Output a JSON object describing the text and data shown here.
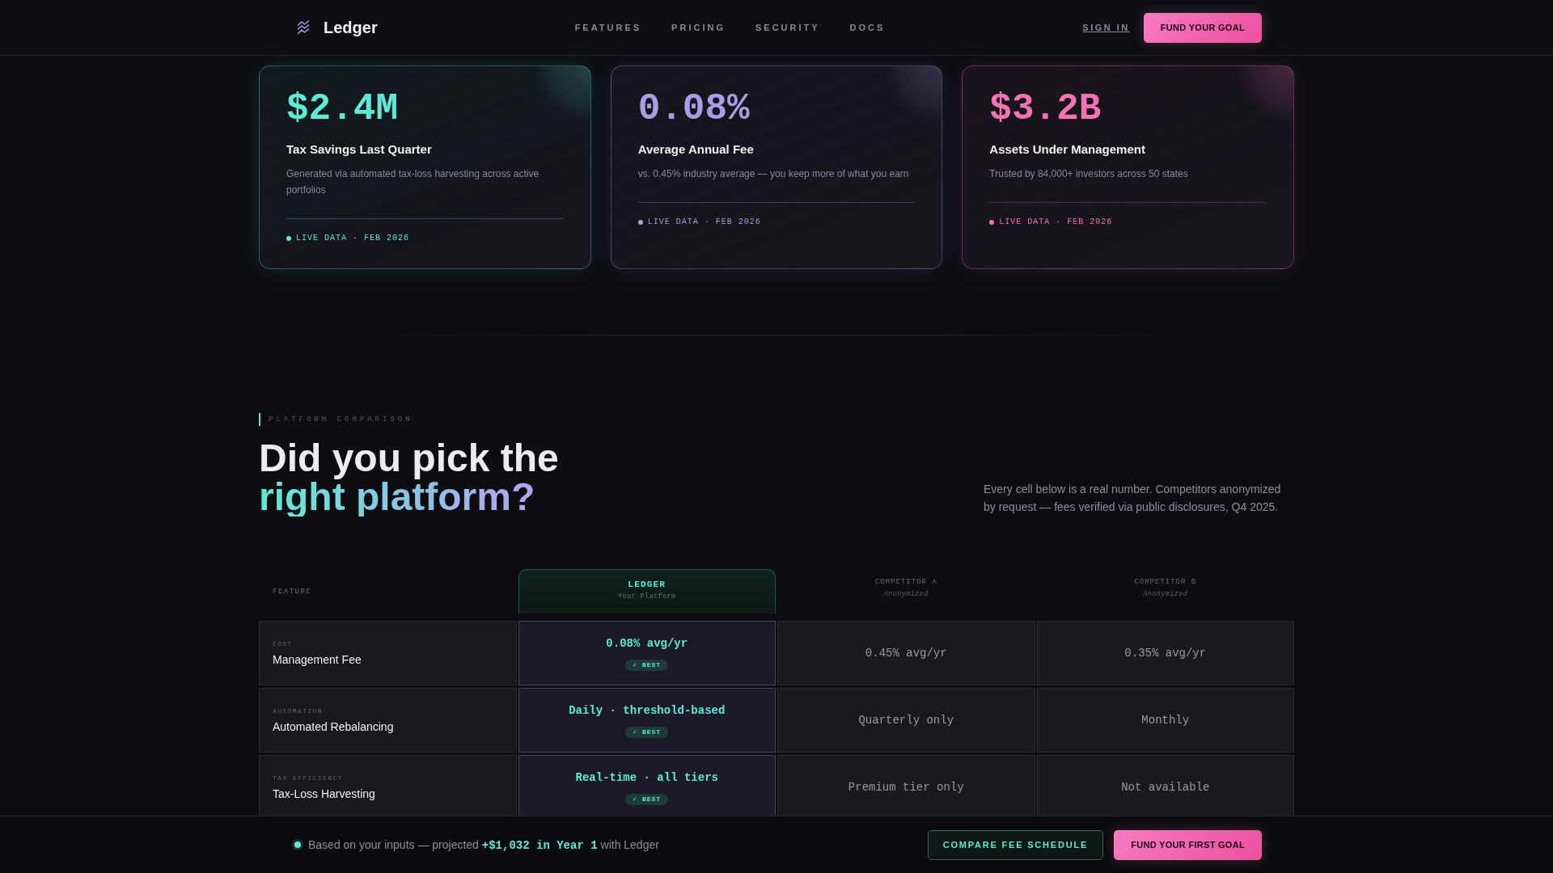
{
  "nav": {
    "brand": "Ledger",
    "links": [
      "FEATURES",
      "PRICING",
      "SECURITY",
      "DOCS"
    ],
    "sign_in": "SIGN IN",
    "cta": "FUND YOUR GOAL"
  },
  "stats": [
    {
      "value": "$2.4M",
      "title": "Tax Savings Last Quarter",
      "description": "Generated via automated tax-loss harvesting across active portfolios",
      "live": "LIVE DATA · FEB 2026",
      "color": "#5eead4"
    },
    {
      "value": "0.08%",
      "title": "Average Annual Fee",
      "description": "vs. 0.45% industry average — you keep more of what you earn",
      "live": "LIVE DATA · FEB 2026",
      "color": "#a99de6"
    },
    {
      "value": "$3.2B",
      "title": "Assets Under Management",
      "description": "Trusted by 84,000+ investors across 50 states",
      "live": "LIVE DATA · FEB 2026",
      "color": "#f472b6"
    }
  ],
  "comparison": {
    "eyebrow": "PLATFORM COMPARISON",
    "heading_line_1": "Did you pick the",
    "heading_line_2": "right platform?",
    "note": "Every cell below is a real number. Competitors anonymized by request — fees verified via public disclosures, Q4 2025.",
    "columns": [
      {
        "kind": "label",
        "title": "FEATURE"
      },
      {
        "kind": "featured",
        "title": "LEDGER",
        "subtitle": "Your Platform"
      },
      {
        "kind": "competitor",
        "title": "COMPETITOR A",
        "subtitle": "Anonymized"
      },
      {
        "kind": "competitor",
        "title": "COMPETITOR B",
        "subtitle": "Anonymized"
      }
    ],
    "rows": [
      {
        "cells": [
          {
            "category": "COST",
            "feature": "Management Fee"
          },
          {
            "value": "0.08% avg/yr",
            "badge": "✓ BEST"
          },
          {
            "value": "0.45% avg/yr"
          },
          {
            "value": "0.35% avg/yr"
          }
        ]
      },
      {
        "cells": [
          {
            "category": "AUTOMATION",
            "feature": "Automated Rebalancing"
          },
          {
            "value": "Daily · threshold-based",
            "badge": "✓ BEST"
          },
          {
            "value": "Quarterly only"
          },
          {
            "value": "Monthly"
          }
        ]
      },
      {
        "cells": [
          {
            "category": "TAX EFFICIENCY",
            "feature": "Tax-Loss Harvesting"
          },
          {
            "value": "Real-time · all tiers",
            "badge": "✓ BEST"
          },
          {
            "value": "Premium tier only"
          },
          {
            "value": "Not available"
          }
        ]
      }
    ]
  },
  "footer_bar": {
    "message": "Based on your inputs — projected **+$1,032 in Year 1** with Ledger",
    "secondary_button": "COMPARE FEE SCHEDULE",
    "primary_button": "FUND YOUR FIRST GOAL"
  }
}
